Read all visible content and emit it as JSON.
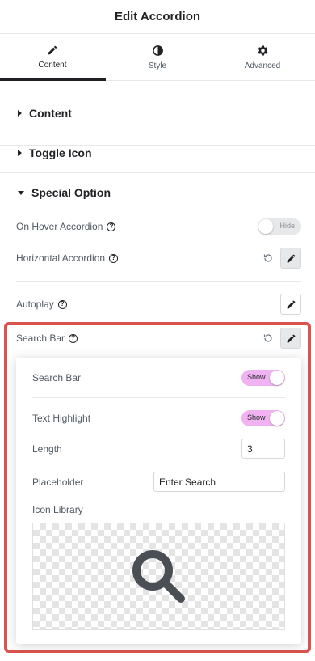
{
  "header": {
    "title": "Edit Accordion"
  },
  "tabs": [
    {
      "label": "Content",
      "icon": "pencil-icon",
      "active": true
    },
    {
      "label": "Style",
      "icon": "contrast-icon",
      "active": false
    },
    {
      "label": "Advanced",
      "icon": "gear-icon",
      "active": false
    }
  ],
  "sections": {
    "content": {
      "label": "Content"
    },
    "toggle_icon": {
      "label": "Toggle Icon"
    },
    "special_option": {
      "label": "Special Option"
    }
  },
  "controls": {
    "on_hover": {
      "label": "On Hover Accordion",
      "toggle_text": "Hide",
      "value": false
    },
    "horizontal": {
      "label": "Horizontal Accordion"
    },
    "autoplay": {
      "label": "Autoplay"
    },
    "search_bar": {
      "label": "Search Bar"
    }
  },
  "popover": {
    "search_bar": {
      "label": "Search Bar",
      "toggle_text": "Show",
      "value": true
    },
    "text_highlight": {
      "label": "Text Highlight",
      "toggle_text": "Show",
      "value": true
    },
    "length": {
      "label": "Length",
      "value": "3"
    },
    "placeholder": {
      "label": "Placeholder",
      "value": "Enter Search"
    },
    "icon_library": {
      "label": "Icon Library",
      "icon": "search-icon"
    }
  },
  "colors": {
    "accent_toggle": "#f0b2f0",
    "highlight_border": "#d9534f",
    "text_dark": "#1f2124",
    "text_muted": "#515962"
  }
}
